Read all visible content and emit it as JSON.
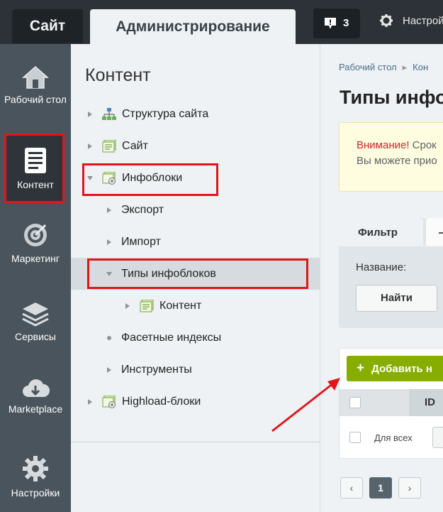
{
  "topbar": {
    "tab_site": "Сайт",
    "tab_admin": "Администрирование",
    "notifications_count": "3",
    "settings_label": "Настройки"
  },
  "left_menu": [
    {
      "label": "Рабочий стол",
      "icon": "home-icon"
    },
    {
      "label": "Контент",
      "icon": "document-icon",
      "active": true
    },
    {
      "label": "Маркетинг",
      "icon": "target-icon"
    },
    {
      "label": "Сервисы",
      "icon": "layers-icon"
    },
    {
      "label": "Marketplace",
      "icon": "cloud-download-icon"
    },
    {
      "label": "Настройки",
      "icon": "gear-icon"
    }
  ],
  "tree": {
    "title": "Контент",
    "items": [
      {
        "label": "Структура сайта",
        "icon": "site-structure-icon",
        "arrow": "right"
      },
      {
        "label": "Сайт",
        "icon": "site-icon",
        "arrow": "right"
      },
      {
        "label": "Инфоблоки",
        "icon": "infoblock-icon",
        "arrow": "down",
        "highlighted": true
      },
      {
        "label": "Экспорт",
        "arrow": "right"
      },
      {
        "label": "Импорт",
        "arrow": "right"
      },
      {
        "label": "Типы инфоблоков",
        "arrow": "down",
        "selected": true,
        "highlighted": true
      },
      {
        "label": "Контент",
        "icon": "site-icon",
        "arrow": "right"
      },
      {
        "label": "Фасетные индексы",
        "arrow": "dot"
      },
      {
        "label": "Инструменты",
        "arrow": "right"
      },
      {
        "label": "Highload-блоки",
        "icon": "infoblock-icon",
        "arrow": "right"
      }
    ]
  },
  "main": {
    "breadcrumb": [
      "Рабочий стол",
      "Кон"
    ],
    "title": "Типы инфо",
    "alert": {
      "warning": "Внимание!",
      "text1": " Срок",
      "text2": "Вы можете прио"
    },
    "filter": {
      "tab_label": "Фильтр",
      "field_label": "Название:",
      "find_button": "Найти"
    },
    "grid": {
      "add_button": "Добавить н",
      "id_header": "ID",
      "row_label": "Для всех"
    },
    "pager": {
      "prev": "‹",
      "current": "1",
      "next": "›"
    }
  },
  "colors": {
    "highlight": "#e1161b",
    "add_button": "#86ad00",
    "sidebar": "#4a545c",
    "topbar": "#2c3237"
  }
}
